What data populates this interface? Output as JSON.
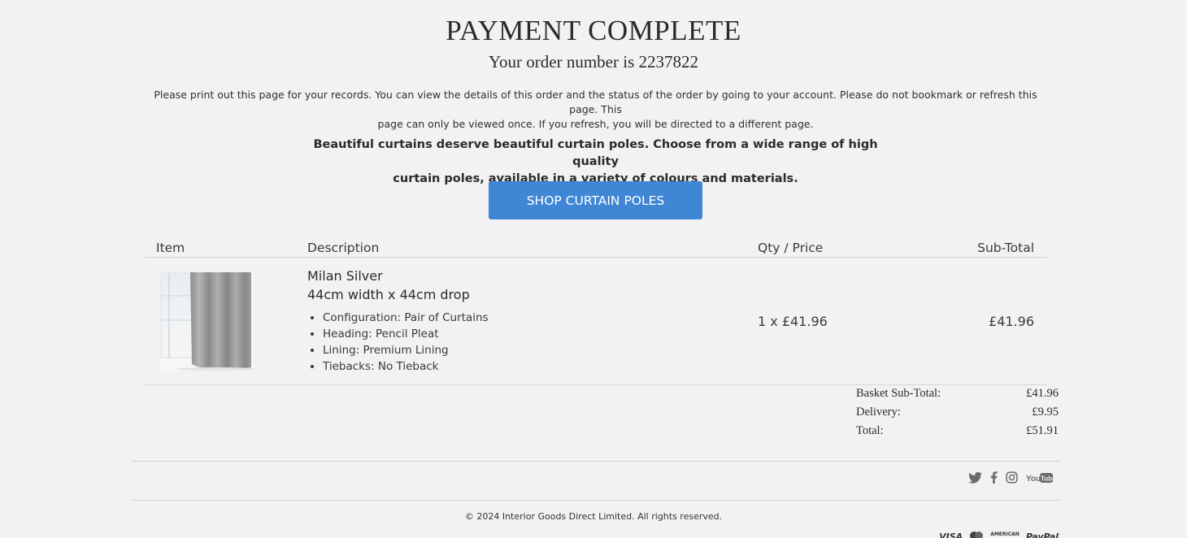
{
  "header": {
    "title": "PAYMENT COMPLETE",
    "order_line": "Your order number is 2237822"
  },
  "notice": {
    "line1": "Please print out this page for your records. You can view the details of this order and the status of the order by going to your account. Please do not bookmark or refresh this page. This",
    "line2": "page can only be viewed once. If you refresh, you will be directed to a different page."
  },
  "promo": {
    "line1": "Beautiful curtains deserve beautiful curtain poles. Choose from a wide range of high quality",
    "line2": "curtain poles, available in a variety of colours and materials.",
    "button_label": "SHOP CURTAIN POLES"
  },
  "table": {
    "headers": {
      "item": "Item",
      "description": "Description",
      "qty_price": "Qty / Price",
      "subtotal": "Sub-Total"
    },
    "rows": [
      {
        "name": "Milan Silver",
        "size": "44cm width x 44cm drop",
        "options": [
          "Configuration: Pair of Curtains",
          "Heading: Pencil Pleat",
          "Lining: Premium Lining",
          "Tiebacks: No Tieback"
        ],
        "qty_price": "1 x £41.96",
        "subtotal": "£41.96"
      }
    ]
  },
  "totals": {
    "basket_label": "Basket Sub-Total:",
    "basket_value": "£41.96",
    "delivery_label": "Delivery:",
    "delivery_value": "£9.95",
    "total_label": "Total:",
    "total_value": "£51.91"
  },
  "footer": {
    "copyright": "© 2024 Interior Goods Direct Limited. All rights reserved.",
    "social_icons": [
      "twitter-icon",
      "facebook-icon",
      "instagram-icon",
      "youtube-icon"
    ],
    "payment_logos": [
      "VISA",
      "AMERICAN",
      "PayPal"
    ]
  },
  "colors": {
    "background": "#f2f2f2",
    "button": "#3f87d5",
    "text": "#2b2b2b"
  }
}
